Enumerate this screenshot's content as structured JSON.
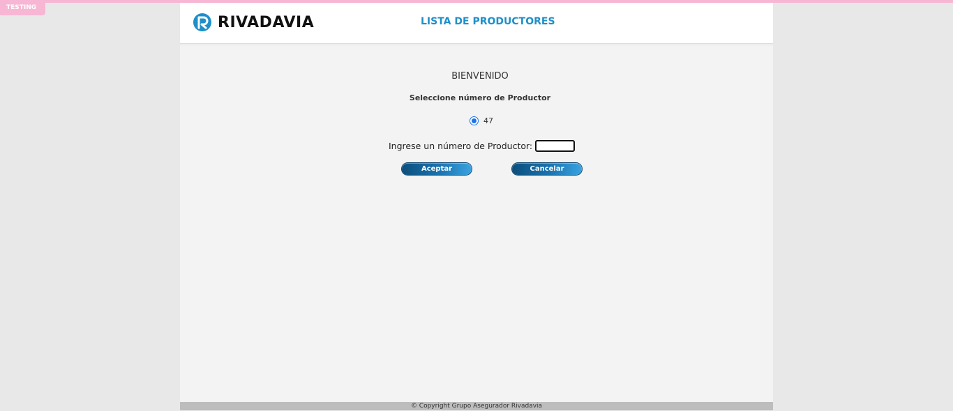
{
  "environment_badge": "TESTING",
  "header": {
    "logo_text": "RIVADAVIA",
    "title": "LISTA DE PRODUCTORES",
    "brand_color": "#1f8fc9"
  },
  "main": {
    "welcome": "BIENVENIDO",
    "subtitle": "Seleccione número de Productor",
    "radio_options": [
      {
        "label": "47",
        "checked": true
      }
    ],
    "input_label": "Ingrese un número de Productor:",
    "input_value": "",
    "accept_label": "Aceptar",
    "cancel_label": "Cancelar"
  },
  "footer": {
    "copyright": "© Copyright Grupo Asegurador Rivadavia"
  }
}
